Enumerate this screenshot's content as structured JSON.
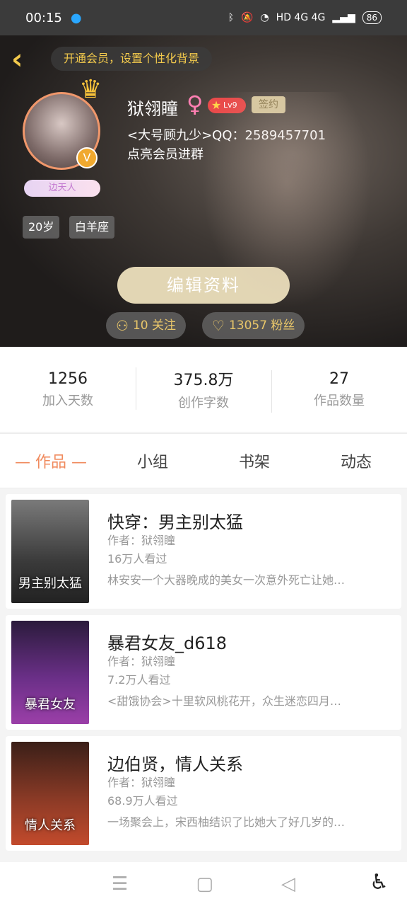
{
  "status_bar": {
    "time": "00:15",
    "network": "HD 4G 4G",
    "battery": "86"
  },
  "header": {
    "vip_banner": "开通会员，设置个性化背景",
    "user_name": "狱翎瞳",
    "level": "Lv9",
    "signed_label": "签约",
    "title_badge": "边天人",
    "bio_lines": [
      "<大号顾九少>QQ：2589457701",
      "点亮会员进群"
    ],
    "tags": [
      "20岁",
      "白羊座"
    ],
    "edit_button": "编辑资料",
    "following": "10 关注",
    "followers": "13057 粉丝"
  },
  "stats": [
    {
      "value": "1256",
      "label": "加入天数"
    },
    {
      "value": "375.8万",
      "label": "创作字数"
    },
    {
      "value": "27",
      "label": "作品数量"
    }
  ],
  "tabs": [
    {
      "label": "— 作品 —",
      "active": true
    },
    {
      "label": "小组",
      "active": false
    },
    {
      "label": "书架",
      "active": false
    },
    {
      "label": "动态",
      "active": false
    }
  ],
  "books": [
    {
      "title": "快穿：男主别太猛",
      "author": "作者：狱翎瞳",
      "views": "16万人看过",
      "desc": "林安安一个大器晚成的美女一次意外死亡让她…",
      "cover_text": "男主别太猛",
      "cover_color": "#4a4a4a"
    },
    {
      "title": "暴君女友_d618",
      "author": "作者：狱翎瞳",
      "views": "7.2万人看过",
      "desc": "<甜饿协会>十里软风桃花开，众生迷恋四月…",
      "cover_text": "暴君女友",
      "cover_color": "#5a2f6e"
    },
    {
      "title": "边伯贤，情人关系",
      "author": "作者：狱翎瞳",
      "views": "68.9万人看过",
      "desc": "一场聚会上，宋西柚结识了比她大了好几岁的…",
      "cover_text": "情人关系",
      "cover_color": "#6b2f22"
    }
  ],
  "accent_color": "#f08a5d"
}
